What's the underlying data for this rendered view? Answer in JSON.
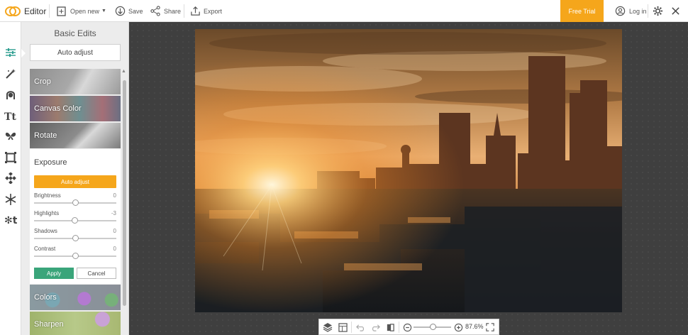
{
  "topbar": {
    "brand": "Editor",
    "open_new": "Open new",
    "save": "Save",
    "share": "Share",
    "export": "Export",
    "free_trial": "Free Trial",
    "login": "Log in"
  },
  "rail": {
    "icons": [
      "sliders-icon",
      "magic-wand-icon",
      "face-icon",
      "text-icon",
      "butterfly-icon",
      "frame-icon",
      "texture-icon",
      "snowflake-icon",
      "design-icon"
    ]
  },
  "panel": {
    "title": "Basic Edits",
    "auto_adjust": "Auto adjust",
    "tiles": {
      "crop": "Crop",
      "canvas_color": "Canvas Color",
      "rotate": "Rotate",
      "colors": "Colors",
      "sharpen": "Sharpen"
    },
    "exposure": {
      "title": "Exposure",
      "auto_adjust": "Auto adjust",
      "sliders": [
        {
          "label": "Brightness",
          "value": "0"
        },
        {
          "label": "Highlights",
          "value": "-3"
        },
        {
          "label": "Shadows",
          "value": "0"
        },
        {
          "label": "Contrast",
          "value": "0"
        }
      ],
      "apply": "Apply",
      "cancel": "Cancel"
    }
  },
  "bottom_toolbar": {
    "zoom": "87.6%"
  },
  "colors": {
    "accent": "#f5a61b",
    "apply": "#3aa57a",
    "active_tool": "#2a9d8f"
  }
}
